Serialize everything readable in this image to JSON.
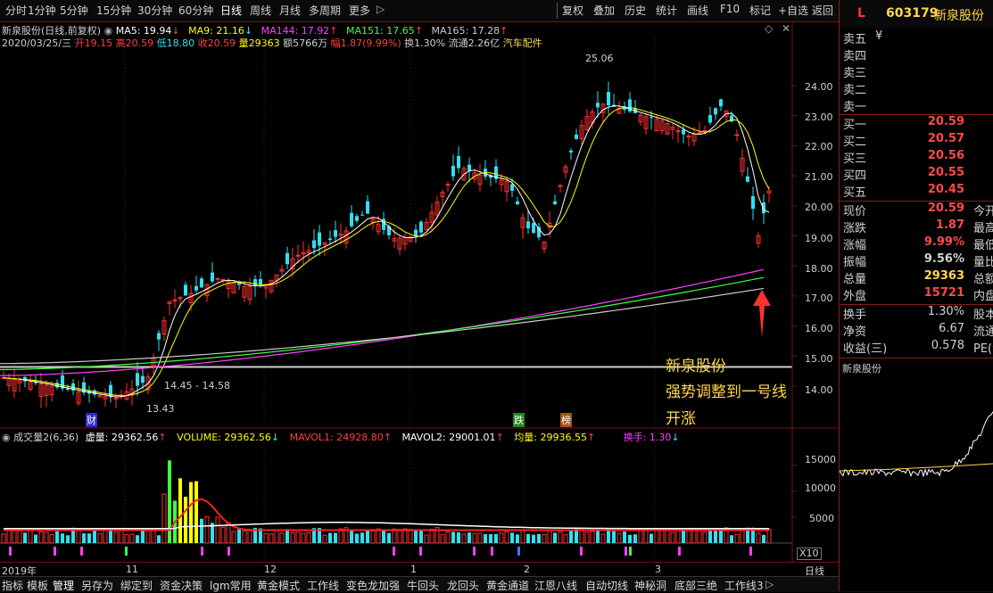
{
  "toolbar": {
    "periods": [
      "分时",
      "1分钟",
      "5分钟",
      "15分钟",
      "30分钟",
      "60分钟",
      "日线",
      "周线",
      "月线",
      "多周期",
      "更多"
    ],
    "active_period": "日线",
    "more_arrow": "▷",
    "right_items": [
      "复权",
      "叠加",
      "历史",
      "统计",
      "画线",
      "F10",
      "标记",
      "+自选",
      "返回"
    ]
  },
  "info": {
    "title": "新泉股份(日线,前复权)",
    "ma": [
      {
        "label": "MA5: 19.94",
        "arrow": "↓",
        "color": "#ffffff"
      },
      {
        "label": "MA9: 21.16",
        "arrow": "↓",
        "color": "#ffff00"
      },
      {
        "label": "MA144: 17.92",
        "arrow": "↑",
        "color": "#ff40ff"
      },
      {
        "label": "MA151: 17.65",
        "arrow": "↑",
        "color": "#40ff40"
      },
      {
        "label": "MA165: 17.28",
        "arrow": "↑",
        "color": "#c8c8c8"
      }
    ],
    "date": "2020/03/25/三",
    "open_label": "开",
    "open": "19.15",
    "high_label": "高",
    "high": "20.59",
    "low_label": "低",
    "low": "18.80",
    "close_label": "收",
    "close": "20.59",
    "vol_label": "量",
    "vol": "29363",
    "amt_label": "额",
    "amt": "5766万",
    "chg_label": "幅",
    "chg": "1.87(9.99%)",
    "turn_label": "换",
    "turn": "1.30%",
    "float_label": "流通",
    "float": "2.26亿",
    "sector": "汽车配件"
  },
  "price_axis": [
    "24.00",
    "23.00",
    "22.00",
    "21.00",
    "20.00",
    "19.00",
    "18.00",
    "17.00",
    "16.00",
    "15.00",
    "14.00"
  ],
  "price_marks": {
    "high": "25.06",
    "low": "13.43",
    "range": "14.45 - 14.58"
  },
  "event_tags": [
    "财",
    "跌",
    "榜"
  ],
  "annotation": [
    "新泉股份",
    "强势调整到一号线",
    "开涨"
  ],
  "volume_info": {
    "name": "成交量2(6,36)",
    "items": [
      {
        "label": "虚量: 29362.56",
        "arrow": "↑",
        "color": "#ffffff"
      },
      {
        "label": "VOLUME: 29362.56",
        "arrow": "↓",
        "color": "#ffff00"
      },
      {
        "label": "MAVOL1: 24928.80",
        "arrow": "↑",
        "color": "#ff4040"
      },
      {
        "label": "MAVOL2: 29001.01",
        "arrow": "↑",
        "color": "#ffffff"
      },
      {
        "label": "均量: 29936.55",
        "arrow": "↑",
        "color": "#ffff00"
      },
      {
        "label": "换手: 1.30",
        "arrow": "↓",
        "color": "#ff40ff"
      }
    ]
  },
  "volume_axis": [
    "15000",
    "10000",
    "5000"
  ],
  "volume_unit": "X10",
  "time_axis": [
    "2019年",
    "11",
    "12",
    "1",
    "2",
    "3"
  ],
  "period_label": "日线",
  "bottom_tabs": [
    "指标",
    "模板",
    "管理",
    "另存为",
    "绑定到",
    "资金决策",
    "lgm常用",
    "黄金模式",
    "工作线",
    "变色龙加强",
    "牛回头",
    "龙回头",
    "黄金通道",
    "江恩八线",
    "自动切线",
    "神秘洞",
    "底部三绝",
    "工作线3"
  ],
  "right_panel": {
    "flag": "L",
    "code": "603179",
    "name": "新泉股份",
    "asks": [
      {
        "label": "卖五",
        "val": "¥"
      },
      {
        "label": "卖四",
        "val": ""
      },
      {
        "label": "卖三",
        "val": ""
      },
      {
        "label": "卖二",
        "val": ""
      },
      {
        "label": "卖一",
        "val": ""
      }
    ],
    "bids": [
      {
        "label": "买一",
        "val": "20.59"
      },
      {
        "label": "买二",
        "val": "20.57"
      },
      {
        "label": "买三",
        "val": "20.56"
      },
      {
        "label": "买四",
        "val": "20.55"
      },
      {
        "label": "买五",
        "val": "20.45"
      }
    ],
    "quote": [
      {
        "label": "现价",
        "val": "20.59",
        "extra": "今开"
      },
      {
        "label": "涨跌",
        "val": "1.87",
        "extra": "最高"
      },
      {
        "label": "涨幅",
        "val": "9.99%",
        "extra": "最低"
      },
      {
        "label": "振幅",
        "val": "9.56%",
        "extra": "量比"
      },
      {
        "label": "总量",
        "val": "29363",
        "extra": "总额"
      },
      {
        "label": "外盘",
        "val": "15721",
        "extra": "内盘"
      }
    ],
    "fin": [
      {
        "label": "换手",
        "val": "1.30%",
        "extra": "股本"
      },
      {
        "label": "净资",
        "val": "6.67",
        "extra": "流通"
      },
      {
        "label": "收益(三)",
        "val": "0.578",
        "extra": "PE(动"
      }
    ],
    "mini_title": "新泉股份"
  },
  "colors": {
    "up": "#ff3030",
    "down": "#30e0f0",
    "accent": "#ffd84a"
  }
}
